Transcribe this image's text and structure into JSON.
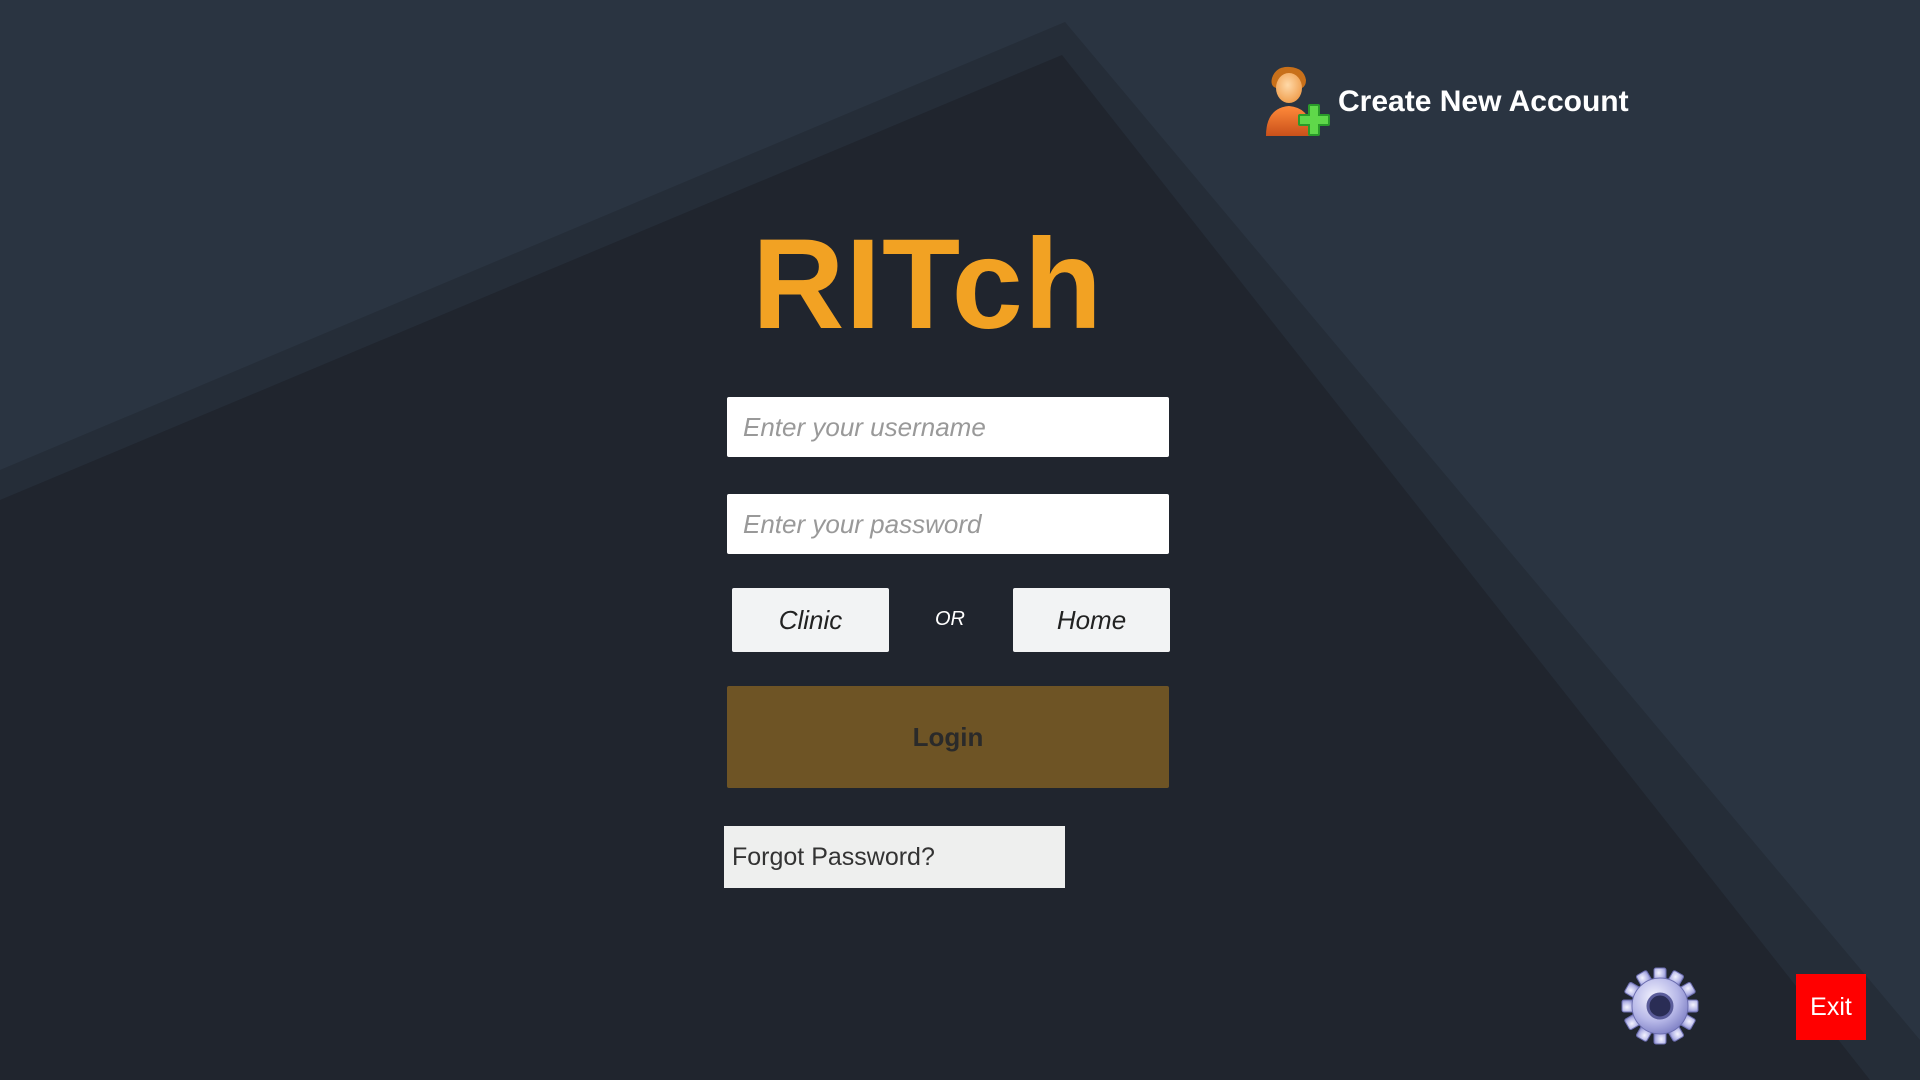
{
  "header": {
    "create_account_label": "Create New Account",
    "create_account_icon": "add-user-icon"
  },
  "app": {
    "title": "RITch",
    "title_color": "#f2a223"
  },
  "form": {
    "username_placeholder": "Enter your username",
    "username_value": "",
    "password_placeholder": "Enter your password",
    "password_value": "",
    "location_options": {
      "clinic_label": "Clinic",
      "separator": "OR",
      "home_label": "Home"
    },
    "login_label": "Login",
    "login_color": "#6e5425",
    "forgot_password_label": "Forgot Password?"
  },
  "footer": {
    "settings_icon": "gear-icon",
    "exit_label": "Exit",
    "exit_color": "#ff0000"
  }
}
